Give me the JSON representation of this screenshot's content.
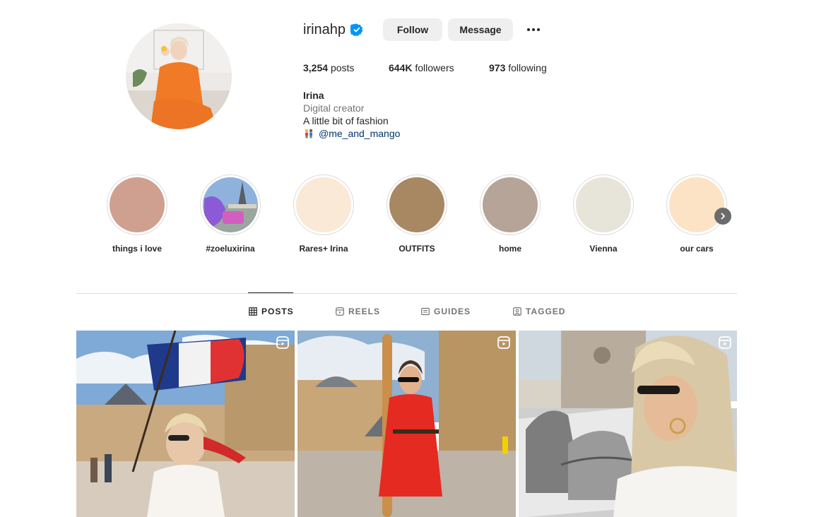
{
  "profile": {
    "username": "irinahp",
    "verified_icon": "verified-badge-icon",
    "follow_label": "Follow",
    "message_label": "Message",
    "more_icon": "more-options-icon"
  },
  "stats": {
    "posts_count": "3,254",
    "posts_label": "posts",
    "followers_count": "644K",
    "followers_label": "followers",
    "following_count": "973",
    "following_label": "following"
  },
  "bio": {
    "name": "Irina",
    "category": "Digital creator",
    "line1": "A little bit of fashion",
    "mention": "@me_and_mango"
  },
  "highlights": [
    {
      "label": "things i love",
      "color": "#d0a08e"
    },
    {
      "label": "#zoeluxirina",
      "color": "#7a9bc4"
    },
    {
      "label": "Rares+ Irina",
      "color": "#f9e9d6"
    },
    {
      "label": "OUTFITS",
      "color": "#a88763"
    },
    {
      "label": "home",
      "color": "#b5a497"
    },
    {
      "label": "Vienna",
      "color": "#e7e4da"
    },
    {
      "label": "our cars",
      "color": "#fde3c6"
    }
  ],
  "tabs": [
    {
      "label": "POSTS",
      "icon": "grid-icon",
      "active": true
    },
    {
      "label": "REELS",
      "icon": "reels-icon",
      "active": false
    },
    {
      "label": "GUIDES",
      "icon": "guides-icon",
      "active": false
    },
    {
      "label": "TAGGED",
      "icon": "tagged-icon",
      "active": false
    }
  ],
  "posts": [
    {
      "type": "reel",
      "icon": "reel-badge-icon"
    },
    {
      "type": "reel",
      "icon": "reel-badge-icon"
    },
    {
      "type": "reel",
      "icon": "reel-badge-icon"
    }
  ],
  "colors": {
    "text_primary": "#262626",
    "text_secondary": "#737373",
    "link": "#00376b",
    "verified_blue": "#0095f6",
    "button_bg": "#efefef",
    "divider": "#dbdbdb"
  }
}
